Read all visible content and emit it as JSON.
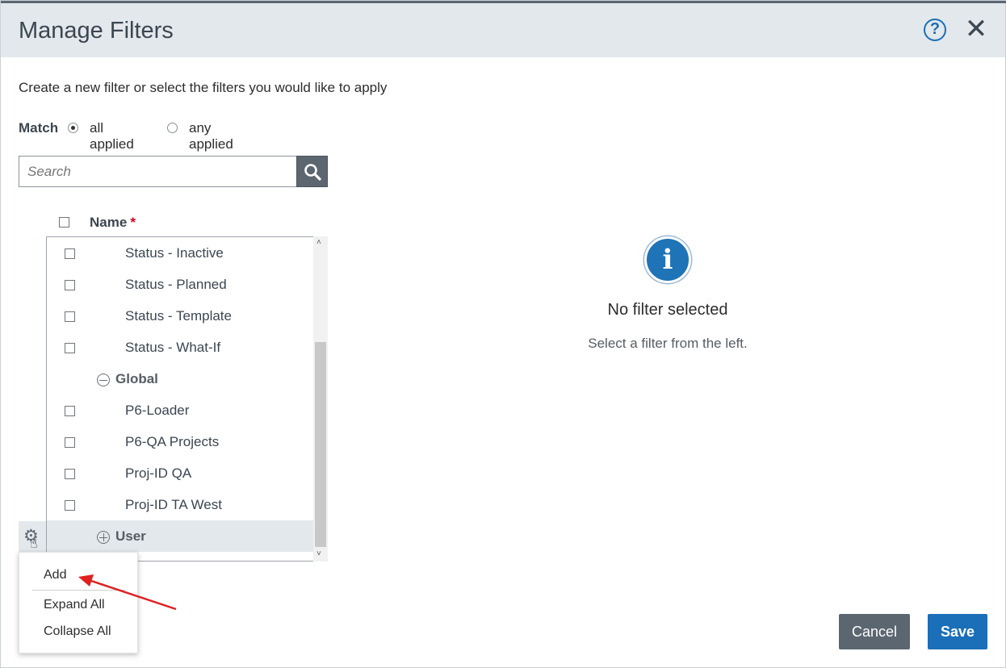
{
  "dialog": {
    "title": "Manage Filters",
    "help_icon": "help-icon",
    "close_icon": "close-icon",
    "close_glyph": "✕",
    "help_glyph": "?"
  },
  "intro_text": "Create a new filter or select the filters you would like to apply",
  "match": {
    "label": "Match",
    "options": [
      {
        "label": "all applied",
        "selected": true
      },
      {
        "label": "any applied",
        "selected": false
      }
    ]
  },
  "search": {
    "placeholder": "Search",
    "icon": "search-icon"
  },
  "list": {
    "column_header": "Name",
    "required_marker": "*",
    "rows": [
      {
        "type": "item",
        "label": "Status - Inactive",
        "checked": false
      },
      {
        "type": "item",
        "label": "Status - Planned",
        "checked": false
      },
      {
        "type": "item",
        "label": "Status - Template",
        "checked": false
      },
      {
        "type": "item",
        "label": "Status - What-If",
        "checked": false
      },
      {
        "type": "group",
        "label": "Global",
        "expanded": true
      },
      {
        "type": "item",
        "label": "P6-Loader",
        "checked": false
      },
      {
        "type": "item",
        "label": "P6-QA Projects",
        "checked": false
      },
      {
        "type": "item",
        "label": "Proj-ID QA",
        "checked": false
      },
      {
        "type": "item",
        "label": "Proj-ID TA West",
        "checked": false
      },
      {
        "type": "group",
        "label": "User",
        "expanded": false
      }
    ]
  },
  "gear_menu": {
    "icon": "gear-icon",
    "items": [
      "Add",
      "Expand All",
      "Collapse All"
    ]
  },
  "empty_state": {
    "icon": "info-icon",
    "icon_glyph": "i",
    "title": "No filter selected",
    "subtitle": "Select a filter from the left."
  },
  "footer": {
    "cancel_label": "Cancel",
    "save_label": "Save"
  },
  "colors": {
    "header_bg": "#e3e8ec",
    "accent": "#1b6fb8",
    "secondary_button": "#5b6670",
    "annotation_arrow": "#e02020"
  }
}
